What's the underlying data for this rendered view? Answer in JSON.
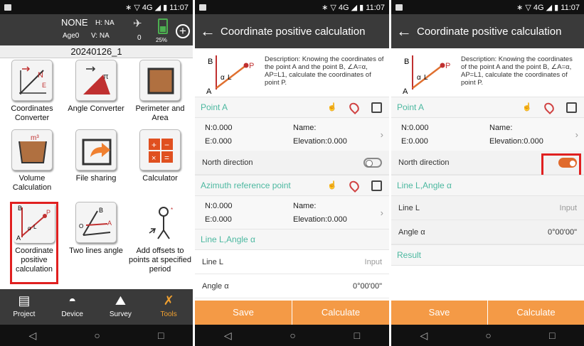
{
  "status": {
    "icons": "∗ ▽ 4G ◢ ▮",
    "time": "11:07"
  },
  "home": {
    "gnss_status": "NONE",
    "h_accuracy": "H: NA",
    "age": "Age0",
    "v_accuracy": "V: NA",
    "sat_count": "0",
    "battery": "25%",
    "project_name": "20240126_1",
    "tiles": [
      {
        "label": "Coordinates Converter"
      },
      {
        "label": "Angle Converter"
      },
      {
        "label": "Perimeter and Area"
      },
      {
        "label": "Volume Calculation"
      },
      {
        "label": "File sharing"
      },
      {
        "label": "Calculator"
      },
      {
        "label": "Coordinate positive calculation"
      },
      {
        "label": "Two lines angle"
      },
      {
        "label": "Add offsets to points at specified period"
      }
    ],
    "tabs": [
      {
        "label": "Project",
        "icon": "project-icon"
      },
      {
        "label": "Device",
        "icon": "device-icon"
      },
      {
        "label": "Survey",
        "icon": "survey-icon"
      },
      {
        "label": "Tools",
        "icon": "tools-icon"
      }
    ]
  },
  "calc": {
    "title": "Coordinate positive calculation",
    "description": "Description: Knowing the coordinates of the point A and the point B, ∠A=α, AP=L1, calculate the coordinates of point P.",
    "diagram": {
      "a": "A",
      "b": "B",
      "p": "P",
      "alpha": "α",
      "l": "L"
    },
    "point_a": "Point A",
    "azimuth": "Azimuth reference point",
    "n": "N:0.000",
    "e": "E:0.000",
    "name": "Name:",
    "elevation": "Elevation:0.000",
    "north_direction": "North direction",
    "line_section": "Line L,Angle α",
    "line_l": "Line L",
    "line_l_placeholder": "Input",
    "angle": "Angle α",
    "angle_value": "0°00'00\"",
    "result": "Result",
    "save": "Save",
    "calculate": "Calculate"
  },
  "colors": {
    "accent": "#4cb8a0",
    "button": "#f49a46",
    "highlight": "#e02020",
    "header": "#3a3a3a"
  }
}
